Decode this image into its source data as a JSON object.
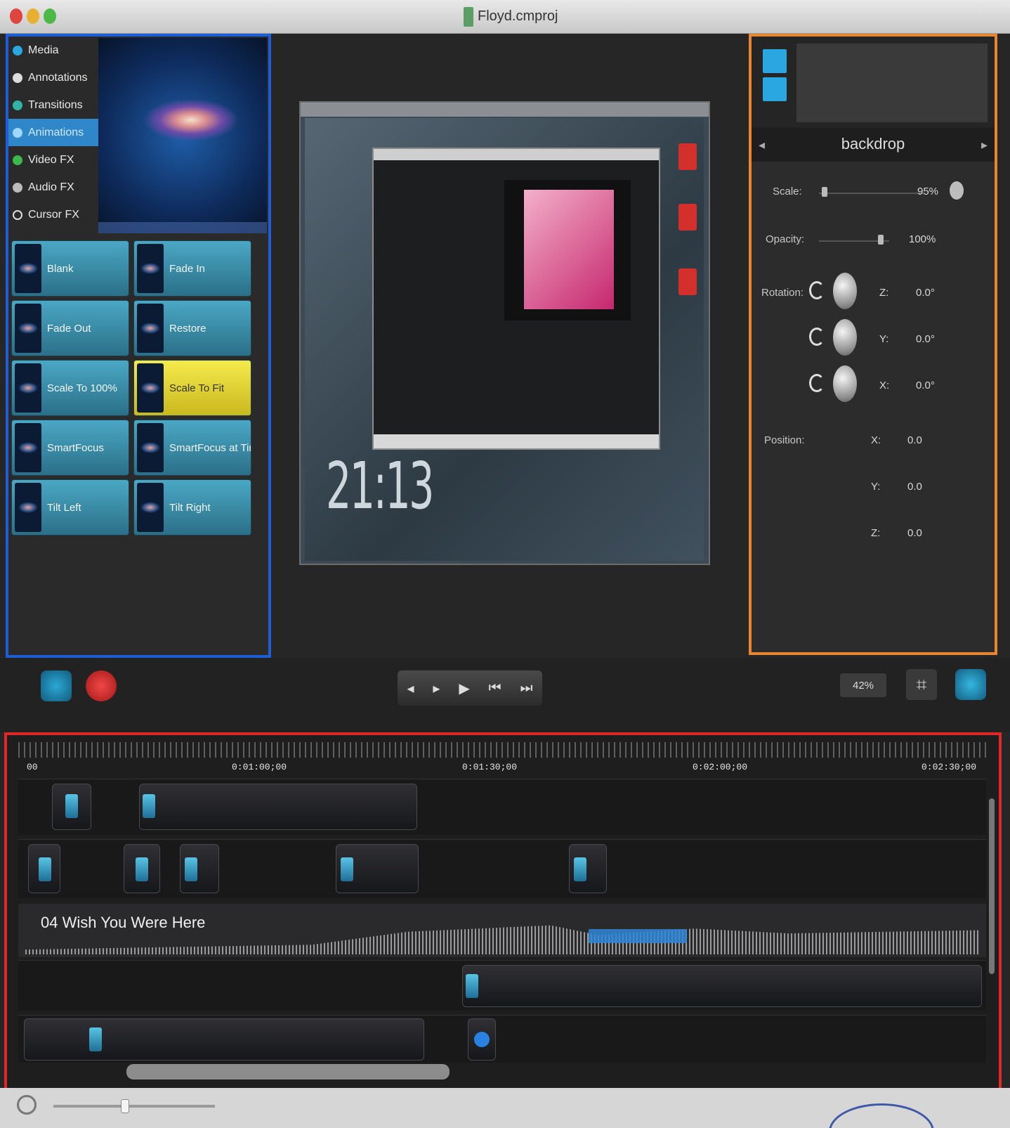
{
  "window": {
    "title": "Floyd.cmproj"
  },
  "library": {
    "categories": [
      {
        "label": "Media",
        "icon": "film-icon"
      },
      {
        "label": "Annotations",
        "icon": "annotation-icon"
      },
      {
        "label": "Transitions",
        "icon": "transition-icon"
      },
      {
        "label": "Animations",
        "icon": "animation-icon",
        "selected": true
      },
      {
        "label": "Video FX",
        "icon": "video-fx-icon"
      },
      {
        "label": "Audio FX",
        "icon": "audio-fx-icon"
      },
      {
        "label": "Cursor FX",
        "icon": "cursor-icon"
      }
    ],
    "animations": [
      {
        "label": "Blank"
      },
      {
        "label": "Fade In"
      },
      {
        "label": "Fade Out"
      },
      {
        "label": "Restore"
      },
      {
        "label": "Scale To 100%"
      },
      {
        "label": "Scale To Fit",
        "highlighted": true
      },
      {
        "label": "SmartFocus"
      },
      {
        "label": "SmartFocus at Time"
      },
      {
        "label": "Tilt Left"
      },
      {
        "label": "Tilt Right"
      }
    ]
  },
  "canvas": {
    "clock_text": "21:13"
  },
  "properties": {
    "name": "backdrop",
    "scale_label": "Scale:",
    "scale_value": "95%",
    "opacity_label": "Opacity:",
    "opacity_value": "100%",
    "rotation_label": "Rotation:",
    "rotation": [
      {
        "axis": "Z:",
        "value": "0.0°"
      },
      {
        "axis": "Y:",
        "value": "0.0°"
      },
      {
        "axis": "X:",
        "value": "0.0°"
      }
    ],
    "position_label": "Position:",
    "position": [
      {
        "axis": "X:",
        "value": "0.0"
      },
      {
        "axis": "Y:",
        "value": "0.0"
      },
      {
        "axis": "Z:",
        "value": "0.0"
      }
    ]
  },
  "transport": {
    "zoom": "42%",
    "prev_label": "◂",
    "next_label": "▸",
    "play_label": "▶",
    "rewind_label": "⏮",
    "ffwd_label": "⏭"
  },
  "timeline": {
    "ticks": [
      "00",
      "0:01:00;00",
      "0:01:30;00",
      "0:02:00;00",
      "0:02:30;00"
    ],
    "audio_clip_title": "04 Wish You Were Here"
  },
  "colors": {
    "library_border": "#1e5dd8",
    "properties_border": "#e88530",
    "timeline_border": "#e02626",
    "accent": "#2aa7e0"
  }
}
